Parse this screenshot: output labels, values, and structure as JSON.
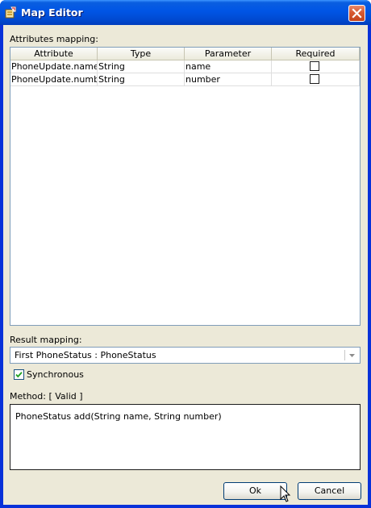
{
  "window": {
    "title": "Map Editor"
  },
  "attributes": {
    "label": "Attributes mapping:",
    "columns": [
      "Attribute",
      "Type",
      "Parameter",
      "Required"
    ],
    "rows": [
      {
        "attribute": "PhoneUpdate.name",
        "type": "String",
        "parameter": "name",
        "required": false
      },
      {
        "attribute": "PhoneUpdate.number",
        "type": "String",
        "parameter": "number",
        "required": false
      }
    ]
  },
  "result": {
    "label": "Result mapping:",
    "selected": "First PhoneStatus : PhoneStatus",
    "synchronous_label": "Synchronous",
    "synchronous_checked": true
  },
  "method": {
    "label": "Method: [ Valid ]",
    "text": "PhoneStatus add(String name, String number)"
  },
  "buttons": {
    "ok": "Ok",
    "cancel": "Cancel"
  },
  "colors": {
    "titlebar": "#0055e5",
    "dialog_bg": "#ece9d8",
    "close_button": "#d75a32",
    "input_border": "#7f9db9"
  },
  "icons": [
    "map-editor-icon",
    "close-icon",
    "dropdown-arrow-icon",
    "checkmark-icon",
    "mouse-pointer-icon"
  ]
}
